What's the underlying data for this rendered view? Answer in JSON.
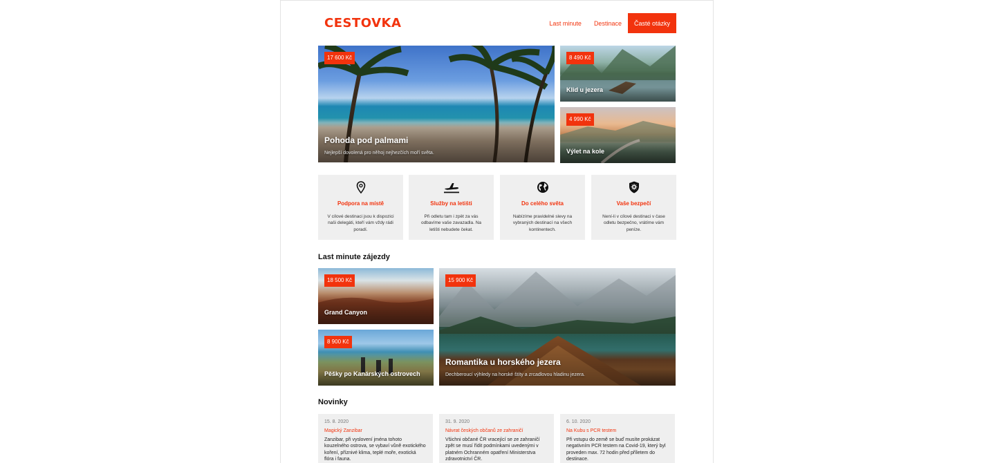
{
  "header": {
    "logo": "CESTOVKA",
    "nav": {
      "last_minute": "Last minute",
      "destinations": "Destinace",
      "faq": "Časté otázky"
    }
  },
  "hero": {
    "main": {
      "price": "17 600 Kč",
      "title": "Pohoda pod palmami",
      "subtitle": "Nejlepší dovolená pro něhoj nejhezčích moří světa."
    },
    "side1": {
      "price": "8 490 Kč",
      "title": "Klid u jezera"
    },
    "side2": {
      "price": "4 990 Kč",
      "title": "Výlet na kole"
    }
  },
  "features": [
    {
      "icon": "location-pin-icon",
      "title": "Podpora na místě",
      "text": "V cílové destinaci jsou k dispozici naši delegáti, kteří vám vždy rádi poradí."
    },
    {
      "icon": "airplane-icon",
      "title": "Služby na letišti",
      "text": "Při odletu tam i zpět za vás odbavíme vaše zavazadla. Na letišti nebudete čekat."
    },
    {
      "icon": "globe-icon",
      "title": "Do celého světa",
      "text": "Nabízíme pravidelné slevy na vybraných destinací na všech kontinentech."
    },
    {
      "icon": "shield-virus-icon",
      "title": "Vaše bezpečí",
      "text": "Není-li v cílové destinaci v čase odletu bezpečno, vrátíme vám peníze."
    }
  ],
  "last_minute": {
    "heading": "Last minute zájezdy",
    "canyon": {
      "price": "18 500 Kč",
      "title": "Grand Canyon"
    },
    "canary": {
      "price": "8 900 Kč",
      "title": "Pěšky po Kanárských ostrovech"
    },
    "lake": {
      "price": "15 900 Kč",
      "title": "Romantika u horského jezera",
      "subtitle": "Dechberoucí výhledy na horské štíty a zrcadlovou hladinu jezera."
    }
  },
  "news": {
    "heading": "Novinky",
    "items": [
      {
        "date": "15. 8. 2020",
        "title": "Magický Zanzibar",
        "text": "Zanzibar, při vyslovení jména tohoto kouzelného ostrova, se vybaví vůně exotického koření, příznivé klima, teplé moře, exotická flóra i fauna."
      },
      {
        "date": "31. 9. 2020",
        "title": "Návrat českých občanů ze zahraničí",
        "text": "Všichni občané ČR vracející se ze zahraničí zpět se musí řídit podmínkami uvedenými v platném Ochranném opatření Ministerstva zdravotnictví ČR."
      },
      {
        "date": "6. 10. 2020",
        "title": "Na Kubu s PCR testem",
        "text": "Při vstupu do země se buď musíte prokázat negativním PCR testem na Covid-19, který byl proveden max. 72 hodin před příletem do destinace."
      }
    ]
  },
  "colors": {
    "accent": "#f2330d",
    "card_bg": "#efefef"
  }
}
